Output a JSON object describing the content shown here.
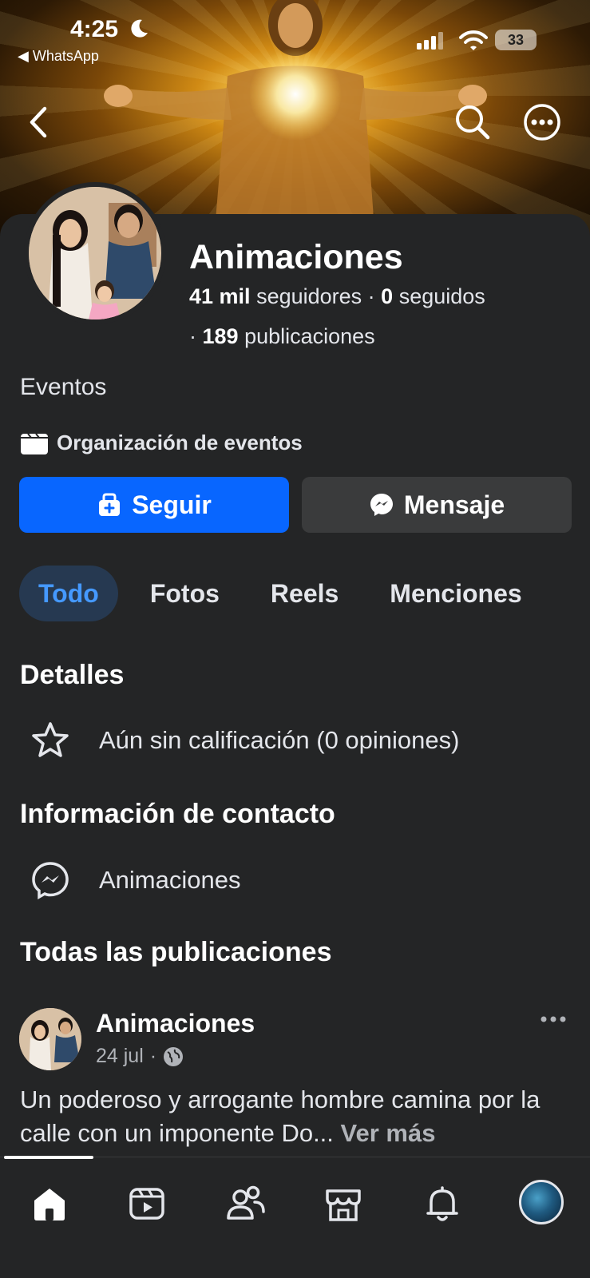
{
  "status_bar": {
    "time": "4:25",
    "back_app": "◀ WhatsApp",
    "battery": "33"
  },
  "header": {
    "icons": [
      "back-chevron-icon",
      "search-icon",
      "more-options-icon"
    ]
  },
  "profile": {
    "name": "Animaciones",
    "followers_count": "41 mil",
    "followers_label": "seguidores",
    "following_count": "0",
    "following_label": "seguidos",
    "posts_count": "189",
    "posts_label": "publicaciones",
    "category": "Eventos",
    "org_label": "Organización de eventos"
  },
  "actions": {
    "follow_label": "Seguir",
    "message_label": "Mensaje",
    "follow_color": "#0866ff"
  },
  "tabs": [
    {
      "label": "Todo",
      "active": true
    },
    {
      "label": "Fotos",
      "active": false
    },
    {
      "label": "Reels",
      "active": false
    },
    {
      "label": "Menciones",
      "active": false
    }
  ],
  "details": {
    "title": "Detalles",
    "rating_text": "Aún sin calificación (0 opiniones)"
  },
  "contact": {
    "title": "Información de contacto",
    "messenger_name": "Animaciones"
  },
  "posts": {
    "title": "Todas las publicaciones",
    "items": [
      {
        "author": "Animaciones",
        "date": "24 jul",
        "text": "Un poderoso y arrogante hombre camina por la calle con un imponente Do...",
        "see_more": "Ver más"
      }
    ]
  },
  "bottom_nav": {
    "items": [
      "home-icon",
      "video-icon",
      "friends-icon",
      "marketplace-icon",
      "notifications-icon",
      "profile-avatar"
    ]
  }
}
